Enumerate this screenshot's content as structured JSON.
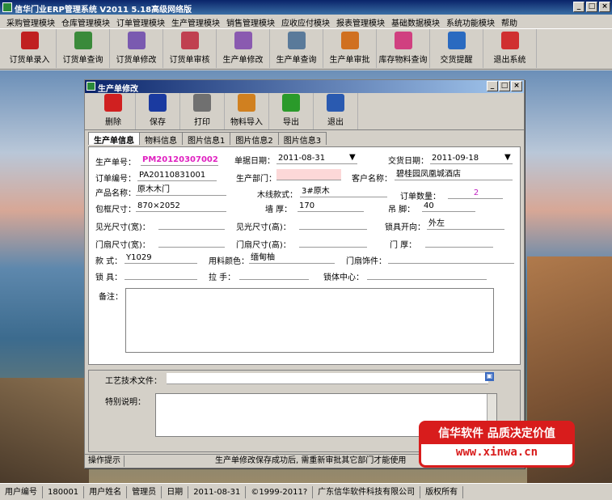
{
  "app": {
    "title": "信华门业ERP管理系统  V2011  5.18高级网络版"
  },
  "menu": [
    "采购管理模块",
    "仓库管理模块",
    "订单管理模块",
    "生产管理模块",
    "销售管理模块",
    "应收应付模块",
    "报表管理模块",
    "基础数据模块",
    "系统功能模块",
    "帮助"
  ],
  "toolbar": [
    {
      "label": "订货单录入",
      "icon": "pdf-icon",
      "color": "#c02020"
    },
    {
      "label": "订货单查询",
      "icon": "brush-icon",
      "color": "#3a8a3a"
    },
    {
      "label": "订货单修改",
      "icon": "feather-icon",
      "color": "#7a5ab0"
    },
    {
      "label": "订货单审核",
      "icon": "crane-icon",
      "color": "#c04050"
    },
    {
      "label": "生产单修改",
      "icon": "feather-icon",
      "color": "#8a5ab0"
    },
    {
      "label": "生产单查询",
      "icon": "pen-icon",
      "color": "#5a7a9a"
    },
    {
      "label": "生产单审批",
      "icon": "fox-icon",
      "color": "#d07020"
    },
    {
      "label": "库存物料查询",
      "icon": "fan-icon",
      "color": "#d04080"
    },
    {
      "label": "交货提醒",
      "icon": "feather-blue-icon",
      "color": "#2a6ac0"
    },
    {
      "label": "退出系统",
      "icon": "power-icon",
      "color": "#d03030"
    }
  ],
  "child": {
    "title": "生产单修改",
    "tools": [
      {
        "label": "删除",
        "icon": "delete-icon",
        "color": "#d02020"
      },
      {
        "label": "保存",
        "icon": "save-icon",
        "color": "#1a3aa0"
      },
      {
        "label": "打印",
        "icon": "printer-icon",
        "color": "#707070"
      },
      {
        "label": "物料导入",
        "icon": "import-icon",
        "color": "#d08020"
      },
      {
        "label": "导出",
        "icon": "export-icon",
        "color": "#2a9a2a"
      },
      {
        "label": "退出",
        "icon": "exit-icon",
        "color": "#2a5ab0"
      }
    ],
    "tabs": [
      "生产单信息",
      "物料信息",
      "图片信息1",
      "图片信息2",
      "图片信息3"
    ]
  },
  "form": {
    "prod_no_label": "生产单号：",
    "prod_no": "PM20120307002",
    "doc_date_label": "单据日期：",
    "doc_date": "2011-08-31",
    "delivery_label": "交货日期：",
    "delivery": "2011-09-18",
    "order_no_label": "订单编号：",
    "order_no": "PA20110831001",
    "dept_label": "生产部门：",
    "dept": "",
    "customer_label": "客户名称：",
    "customer": "碧桂园凤凰城酒店",
    "product_label": "产品名称：",
    "product": "原木木门",
    "wood_label": "木线款式：",
    "wood": "3#原木",
    "qty_label": "订单数量：",
    "qty": "2",
    "frame_label": "包框尺寸：",
    "frame": "870×2052",
    "wall_label": "墙 厚：",
    "wall": "170",
    "foot_label": "吊 脚：",
    "foot": "40",
    "light_w_label": "见光尺寸(宽)：",
    "light_w": "",
    "light_h_label": "见光尺寸(高)：",
    "light_h": "",
    "lock_dir_label": "锁具开向：",
    "lock_dir": "外左",
    "leaf_w_label": "门扇尺寸(宽)：",
    "leaf_w": "",
    "leaf_h_label": "门扇尺寸(高)：",
    "leaf_h": "",
    "door_thick_label": "门 厚：",
    "door_thick": "",
    "style_label": "款 式：",
    "style": "Y1029",
    "color_label": "用料颜色：",
    "color": "缅甸柚",
    "trim_label": "门扇饰件：",
    "trim": "",
    "lock_label": "锁 具：",
    "lock": "",
    "handle_label": "拉 手：",
    "handle": "",
    "lock_center_label": "锁体中心：",
    "lock_center": "",
    "memo_label": "备注：",
    "tech_label": "工艺技术文件：",
    "special_label": "特别说明："
  },
  "child_status": {
    "hint": "操作提示",
    "msg": "生产单修改保存成功后, 需重新审批其它部门才能使用"
  },
  "ad": {
    "line1": "信华软件 品质决定价值",
    "line2": "www.xinwa.cn"
  },
  "status": [
    "用户编号",
    "180001",
    "用户姓名",
    "管理员",
    "日期",
    "2011-08-31",
    "©1999-2011?",
    "广东信华软件科技有限公司",
    "版权所有"
  ]
}
